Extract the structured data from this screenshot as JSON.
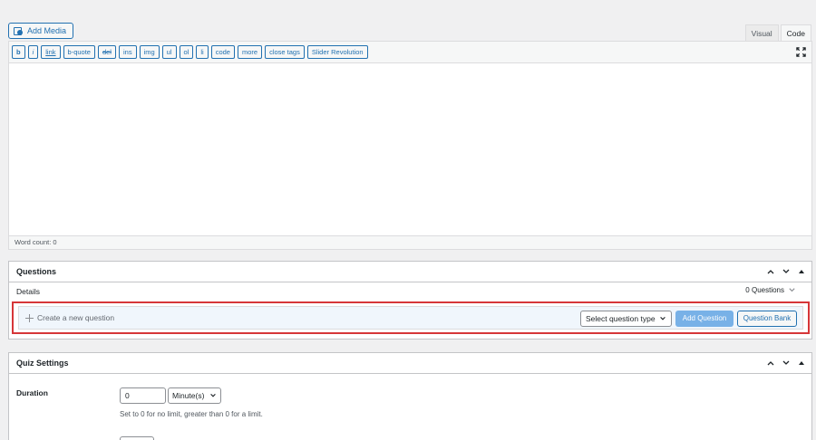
{
  "media": {
    "add_media_label": "Add Media"
  },
  "mode_tabs": [
    {
      "label": "Visual"
    },
    {
      "label": "Code"
    }
  ],
  "toolbar": {
    "buttons": [
      {
        "label": "b"
      },
      {
        "label": "i"
      },
      {
        "label": "link"
      },
      {
        "label": "b-quote"
      },
      {
        "label": "del"
      },
      {
        "label": "ins"
      },
      {
        "label": "img"
      },
      {
        "label": "ul"
      },
      {
        "label": "ol"
      },
      {
        "label": "li"
      },
      {
        "label": "code"
      },
      {
        "label": "more"
      },
      {
        "label": "close tags"
      },
      {
        "label": "Slider Revolution"
      }
    ]
  },
  "editor": {
    "word_count": "Word count: 0"
  },
  "questions": {
    "title": "Questions",
    "details_label": "Details",
    "count_label": "0 Questions",
    "new_question_placeholder": "Create a new question",
    "select_type_label": "Select question type",
    "add_question_label": "Add Question",
    "question_bank_label": "Question Bank"
  },
  "quiz_settings": {
    "title": "Quiz Settings",
    "duration_label": "Duration",
    "duration_value": "0",
    "duration_unit": "Minute(s)",
    "duration_help": "Set to 0 for no limit, greater than 0 for a limit."
  },
  "colors": {
    "accent": "#2271b1",
    "highlight_border": "#d63638",
    "add_button": "#72aee6"
  }
}
